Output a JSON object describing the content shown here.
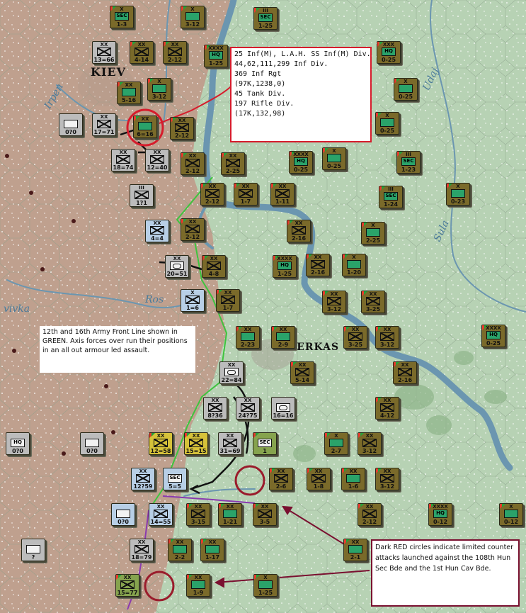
{
  "map": {
    "cities": [
      "Kiev",
      "Cherkasy"
    ],
    "city_labels": [
      "KIEV",
      "HERKAS"
    ],
    "rivers": [
      "Irpen",
      "Udaj",
      "Sula",
      "Ros"
    ],
    "river_labels": [
      "Irpen",
      "Udaj",
      "Sula",
      "Ros",
      "vivka"
    ],
    "colors": {
      "river": "#6b96b0",
      "front_line": "#3ec43e",
      "axis_arrow": "#111111",
      "counterattack_circle": "#9a1c2c",
      "note_border_red": "#d61c2c"
    }
  },
  "notes": {
    "intel": {
      "lines": [
        "25 Inf(M), L.A.H. SS Inf(M) Div.",
        "44,62,111,299 Inf Div.",
        "369 Inf Rgt",
        "(97K,1238,0)",
        "",
        "45 Tank Div.",
        "197 Rifle Div.",
        "(17K,132,98)"
      ]
    },
    "front": {
      "text": "12th and 16th Army Front Line shown in GREEN.  Axis forces over run their positions in an all out armour led assault."
    },
    "counter": {
      "text": "Dark RED circles indicate limited counter attacks launched against the 108th Hun Sec Bde and the 1st Hun Cav Bde."
    }
  },
  "counters": [
    {
      "side": "sov",
      "size": "X",
      "sym": "SEC",
      "str": "1-3"
    },
    {
      "side": "sov",
      "size": "X",
      "sym": "",
      "str": "3-12"
    },
    {
      "side": "sov",
      "size": "III",
      "sym": "SEC",
      "str": "1-25"
    },
    {
      "side": "ger",
      "size": "XX",
      "sym": "inf",
      "str": "13=66"
    },
    {
      "side": "sov",
      "size": "XX",
      "sym": "inf",
      "str": "4-14"
    },
    {
      "side": "sov",
      "size": "XX",
      "sym": "inf",
      "str": "2-12"
    },
    {
      "side": "sov",
      "size": "XXXX",
      "sym": "HQ",
      "str": "1-25"
    },
    {
      "side": "sov",
      "size": "XXX",
      "sym": "HQ",
      "str": "0-25"
    },
    {
      "side": "sov",
      "size": "X",
      "sym": "",
      "str": "0-25"
    },
    {
      "side": "sov",
      "size": "XX",
      "sym": "",
      "str": "5-16"
    },
    {
      "side": "sov",
      "size": "X",
      "sym": "",
      "str": "3-12"
    },
    {
      "side": "ger",
      "size": "",
      "sym": "",
      "str": "0?0"
    },
    {
      "side": "ger",
      "size": "XX",
      "sym": "inf",
      "str": "17=71"
    },
    {
      "side": "sov",
      "size": "XX",
      "sym": "",
      "str": "6=16"
    },
    {
      "side": "sov",
      "size": "XX",
      "sym": "inf",
      "str": "2-12"
    },
    {
      "side": "sov",
      "size": "X",
      "sym": "",
      "str": "0-25"
    },
    {
      "side": "ger",
      "size": "XX",
      "sym": "inf",
      "str": "18=74"
    },
    {
      "side": "ger",
      "size": "XX",
      "sym": "inf",
      "str": "12=40"
    },
    {
      "side": "sov",
      "size": "XX",
      "sym": "inf",
      "str": "2-12"
    },
    {
      "side": "sov",
      "size": "XX",
      "sym": "inf",
      "str": "2-25"
    },
    {
      "side": "sov",
      "size": "XXXX",
      "sym": "HQ",
      "str": "0-25"
    },
    {
      "side": "sov",
      "size": "X",
      "sym": "",
      "str": "0-25"
    },
    {
      "side": "sov",
      "size": "III",
      "sym": "SEC",
      "str": "1-23"
    },
    {
      "side": "ger",
      "size": "III",
      "sym": "inf",
      "str": "1?1"
    },
    {
      "side": "sov",
      "size": "XX",
      "sym": "inf",
      "str": "2-12"
    },
    {
      "side": "sov",
      "size": "XX",
      "sym": "inf",
      "str": "1-7"
    },
    {
      "side": "sov",
      "size": "XX",
      "sym": "inf",
      "str": "1-11"
    },
    {
      "side": "sov",
      "size": "III",
      "sym": "SEC",
      "str": "1-24"
    },
    {
      "side": "sov",
      "size": "X",
      "sym": "",
      "str": "0-23"
    },
    {
      "side": "lgerman",
      "size": "XX",
      "sym": "inf",
      "str": "4=4"
    },
    {
      "side": "sov",
      "size": "XX",
      "sym": "inf",
      "str": "2-12"
    },
    {
      "side": "sov",
      "size": "XX",
      "sym": "inf",
      "str": "2-16"
    },
    {
      "side": "sov",
      "size": "X",
      "sym": "",
      "str": "2-25"
    },
    {
      "side": "ger",
      "size": "XX",
      "sym": "arm",
      "str": "20=51"
    },
    {
      "side": "sov",
      "size": "XX",
      "sym": "inf",
      "str": "4-8"
    },
    {
      "side": "sov",
      "size": "XXXX",
      "sym": "HQ",
      "str": "1-25"
    },
    {
      "side": "sov",
      "size": "XX",
      "sym": "inf",
      "str": "2-16"
    },
    {
      "side": "sov",
      "size": "X",
      "sym": "",
      "str": "1-20"
    },
    {
      "side": "lgerman",
      "size": "X",
      "sym": "inf",
      "str": "1=6"
    },
    {
      "side": "sov",
      "size": "XX",
      "sym": "inf",
      "str": "1-7"
    },
    {
      "side": "sov",
      "size": "XX",
      "sym": "inf",
      "str": "3-12"
    },
    {
      "side": "sov-tan",
      "size": "XX",
      "sym": "inf",
      "str": "3-25"
    },
    {
      "side": "sov",
      "size": "XX",
      "sym": "",
      "str": "2-23"
    },
    {
      "side": "sov",
      "size": "XX",
      "sym": "",
      "str": "2-9"
    },
    {
      "side": "sov",
      "size": "XX",
      "sym": "inf",
      "str": "3-25"
    },
    {
      "side": "sov-tan",
      "size": "XX",
      "sym": "inf",
      "str": "3-12"
    },
    {
      "side": "sov",
      "size": "XXXX",
      "sym": "HQ",
      "str": "0-25"
    },
    {
      "side": "ger",
      "size": "XX",
      "sym": "arm",
      "str": "22=84"
    },
    {
      "side": "sov",
      "size": "XX",
      "sym": "inf",
      "str": "5-14"
    },
    {
      "side": "sov-tan",
      "size": "XX",
      "sym": "inf",
      "str": "2-16"
    },
    {
      "side": "ger",
      "size": "XX",
      "sym": "inf",
      "str": "8?36"
    },
    {
      "side": "ger",
      "size": "XX",
      "sym": "inf",
      "str": "24?75"
    },
    {
      "side": "ger",
      "size": "",
      "sym": "arm",
      "str": "16=16"
    },
    {
      "side": "sov-tan",
      "size": "XX",
      "sym": "inf",
      "str": "4-12"
    },
    {
      "side": "ger",
      "size": "",
      "sym": "HQ",
      "str": "0?0"
    },
    {
      "side": "ger",
      "size": "",
      "sym": "",
      "str": "0?0"
    },
    {
      "side": "ital",
      "size": "XX",
      "sym": "inf",
      "str": "12=58"
    },
    {
      "side": "ital",
      "size": "XX",
      "sym": "inf",
      "str": "15=15"
    },
    {
      "side": "ger",
      "size": "XX",
      "sym": "inf",
      "str": "31=69"
    },
    {
      "side": "hun",
      "size": "",
      "sym": "SEC",
      "str": "1"
    },
    {
      "side": "sov",
      "size": "X",
      "sym": "",
      "str": "2-7"
    },
    {
      "side": "sov-tan",
      "size": "XX",
      "sym": "inf",
      "str": "3-12"
    },
    {
      "side": "lgerman",
      "size": "XX",
      "sym": "inf",
      "str": "12?59"
    },
    {
      "side": "lgerman",
      "size": "",
      "sym": "SEC",
      "str": "5=5"
    },
    {
      "side": "sov",
      "size": "XX",
      "sym": "inf",
      "str": "2-6"
    },
    {
      "side": "sov",
      "size": "XX",
      "sym": "inf",
      "str": "1-8"
    },
    {
      "side": "sov",
      "size": "XX",
      "sym": "",
      "str": "1-6"
    },
    {
      "side": "sov-tan",
      "size": "XX",
      "sym": "inf",
      "str": "3-12"
    },
    {
      "side": "lgerman",
      "size": "",
      "sym": "",
      "str": "0?0"
    },
    {
      "side": "lgerman",
      "size": "XX",
      "sym": "inf",
      "str": "14=55"
    },
    {
      "side": "sov",
      "size": "XX",
      "sym": "inf",
      "str": "3-15"
    },
    {
      "side": "sov",
      "size": "XX",
      "sym": "",
      "str": "1-21"
    },
    {
      "side": "sov",
      "size": "XX",
      "sym": "inf",
      "str": "3-5"
    },
    {
      "side": "sov",
      "size": "XX",
      "sym": "inf",
      "str": "2-12"
    },
    {
      "side": "sov",
      "size": "XXXX",
      "sym": "HQ",
      "str": "0-12"
    },
    {
      "side": "sov",
      "size": "X",
      "sym": "",
      "str": "0-12"
    },
    {
      "side": "ger",
      "size": "",
      "sym": "",
      "str": "?"
    },
    {
      "side": "ger",
      "size": "XX",
      "sym": "inf",
      "str": "18=79"
    },
    {
      "side": "sov",
      "size": "XX",
      "sym": "",
      "str": "2-2"
    },
    {
      "side": "sov",
      "size": "XX",
      "sym": "",
      "str": "1-17"
    },
    {
      "side": "sov",
      "size": "XX",
      "sym": "",
      "str": "2-1"
    },
    {
      "side": "hun",
      "size": "XX",
      "sym": "inf",
      "str": "15=77"
    },
    {
      "side": "sov",
      "size": "XX",
      "sym": "",
      "str": "1-9"
    },
    {
      "side": "sov",
      "size": "X",
      "sym": "",
      "str": "1-25"
    }
  ]
}
